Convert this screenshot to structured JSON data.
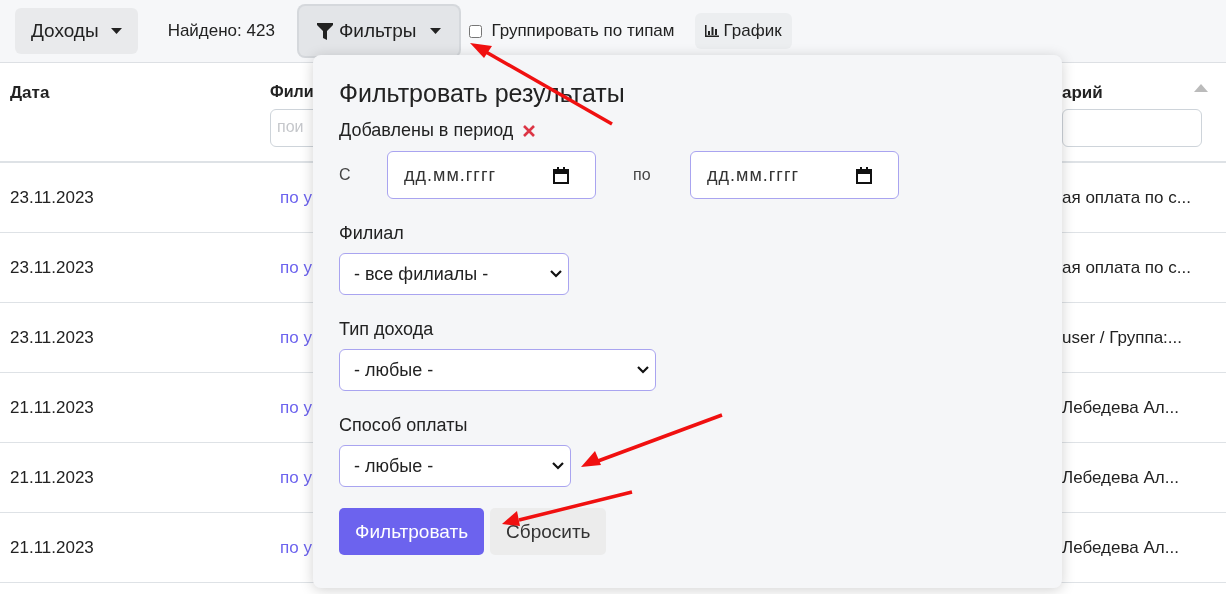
{
  "toolbar": {
    "menu_button": "Доходы",
    "found": "Найдено: 423",
    "filter_button": {
      "label": "Фильтры",
      "expanded": true
    },
    "group_checkbox": {
      "label": "Группировать по типам",
      "checked": false
    },
    "chart_button": "График"
  },
  "table": {
    "columns": [
      {
        "label": "Дата",
        "kind": "plain"
      },
      {
        "label": "Фили",
        "kind": "search",
        "placeholder": "пои"
      },
      {
        "label": "арий",
        "kind": "search",
        "sorted": true
      }
    ],
    "rows": [
      {
        "date": "23.11.2023",
        "column_2": "по у",
        "column_3": "ая оплата по с..."
      },
      {
        "date": "23.11.2023",
        "column_2": "по у",
        "column_3": "ая оплата по с..."
      },
      {
        "date": "23.11.2023",
        "column_2": "по у",
        "column_3": "user / Группа:..."
      },
      {
        "date": "21.11.2023",
        "column_2": "по у",
        "column_3": "Лебедева Ал..."
      },
      {
        "date": "21.11.2023",
        "column_2": "по у",
        "column_3": "Лебедева Ал..."
      },
      {
        "date": "21.11.2023",
        "column_2": "по у",
        "column_3": "Лебедева Ал..."
      }
    ]
  },
  "filter_panel": {
    "title": "Фильтровать результаты",
    "period": {
      "label": "Добавлены в период",
      "clearable": true,
      "from_label": "С",
      "from_placeholder": "дд.мм.гггг",
      "to_label": "по",
      "to_placeholder": "дд.мм.гггг"
    },
    "selects": [
      {
        "label": "Филиал",
        "value": "- все филиалы -"
      },
      {
        "label": "Тип дохода",
        "value": "- любые -"
      },
      {
        "label": "Способ оплаты",
        "value": "- любые -"
      }
    ],
    "submit_button": "Фильтровать",
    "reset_button": "Сбросить"
  }
}
